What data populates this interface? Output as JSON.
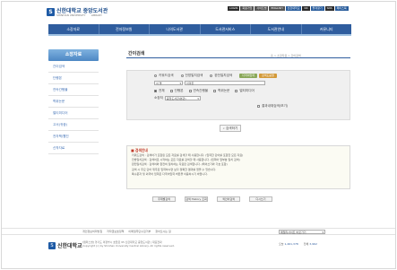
{
  "header": {
    "univ_name": "신한대학교",
    "univ_sub": "SHINHAN UNIVERSITY",
    "library_name": "중앙도서관",
    "library_sub": "LIBRARY",
    "badge": "",
    "util": [
      "LOGIN",
      "회원가입",
      "사이트맵",
      "ENGLISH",
      "신한대학교",
      "KR",
      "즐겨찾기",
      "SNS",
      "페이스북"
    ]
  },
  "gnb": [
    "소장자료",
    "전자정보원",
    "나의도서관",
    "도서관서비스",
    "도서관안내",
    "커뮤니티"
  ],
  "lnb": {
    "title": "소장자료",
    "items": [
      "간이검색",
      "단행본",
      "연속간행물",
      "학위논문",
      "멀티미디어",
      "고서(귀중)",
      "전자책/웹진",
      "신착자료",
      "추천도서"
    ]
  },
  "page": {
    "title": "간이검색",
    "breadcrumb": "홈 > 소장자료 > 간이검색"
  },
  "search": {
    "scope_options": [
      "키워드검색",
      "전방일치검색",
      "완전일치검색"
    ],
    "scope_selected": 0,
    "btn_advanced": "다국어입력",
    "btn_help": "검색도움말",
    "field_select": "서 명",
    "query": "아마존",
    "material_types": [
      {
        "label": "전체",
        "checked": true
      },
      {
        "label": "단행본",
        "checked": false
      },
      {
        "label": "연속간행물",
        "checked": false
      },
      {
        "label": "학위논문",
        "checked": false
      },
      {
        "label": "멀티미디어",
        "checked": false
      }
    ],
    "location_label": "소장처",
    "location_select": "중앙도서관(본관)",
    "result_limit_label": "결과내재검색(보기)",
    "submit_label": "검색하기"
  },
  "guide": {
    "title": "검색안내",
    "lines": [
      "키워드검색 : 검색어가 포함된 모든 자료를 검색할 때 사용합니다. (입력한 단어를 포함한 모든 자료)",
      "전방일치검색 : 검색어로 시작하는 모든 자료를 검색할 때 사용합니다. (입력어 앞부분 일치 검색)",
      "완전일치검색 : 검색어와 완전히 일치하는 자료만 검색합니다. (띄어쓰기와 기호 포함)",
      "검색 시 주요 단어 위주로 입력하시면 보다 정확한 결과를 얻을 수 있습니다.",
      "특수문자 및 외국어 입력은 다국어입력 버튼을 이용하시기 바랍니다."
    ]
  },
  "buttons": [
    "주제별검색",
    "검색 History 조회",
    "색인어검색",
    "다시쓰기"
  ],
  "footer": {
    "links": [
      "개인정보처리방침",
      "저작권보호정책",
      "이메일무단수집거부",
      "찾아오시는 길"
    ],
    "family_select": "패밀리사이트 바로가기",
    "univ_name": "신한대학교",
    "address": "[캠퍼스명] 경기도 의정부시 호암로 95 신한대학교 중앙도서관 | 대표전화",
    "copyright": "Copyright (c) by Shinhan University Central Library. All rights reserved.",
    "stats": [
      {
        "label": "오늘",
        "value": "1,461,378"
      },
      {
        "label": "전체",
        "value": "3,962"
      }
    ]
  },
  "colors": {
    "primary": "#2f5d9e",
    "accent_green": "#8aa85a",
    "accent_orange": "#d39a3a",
    "guide_title": "#c0392b"
  }
}
